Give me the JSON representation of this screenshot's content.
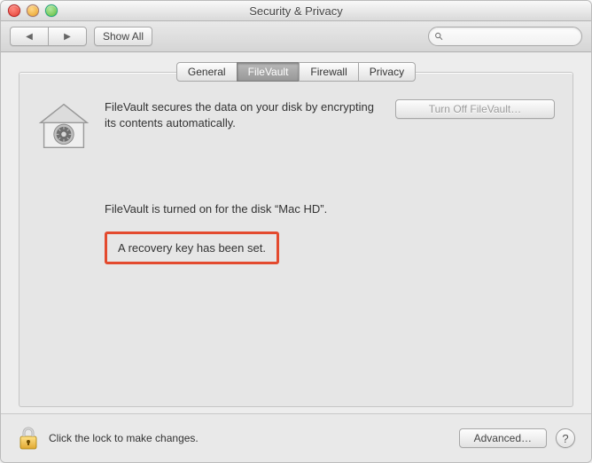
{
  "window": {
    "title": "Security & Privacy"
  },
  "toolbar": {
    "show_all": "Show All"
  },
  "search": {
    "placeholder": ""
  },
  "tabs": {
    "general": "General",
    "filevault": "FileVault",
    "firewall": "Firewall",
    "privacy": "Privacy"
  },
  "filevault": {
    "description": "FileVault secures the data on your disk by encrypting its contents automatically.",
    "turn_off_label": "Turn Off FileVault…",
    "status": "FileVault is turned on for the disk “Mac HD”.",
    "recovery": "A recovery key has been set."
  },
  "footer": {
    "lock_text": "Click the lock to make changes.",
    "advanced_label": "Advanced…"
  }
}
